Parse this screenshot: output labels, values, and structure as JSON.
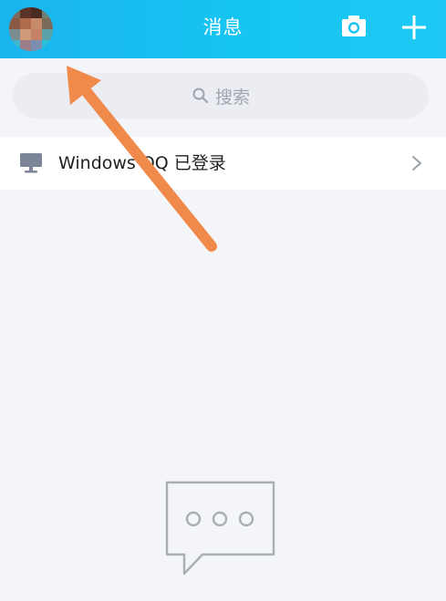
{
  "header": {
    "title": "消息",
    "camera_icon": "camera-icon",
    "add_icon": "plus-icon"
  },
  "search": {
    "placeholder": "搜索",
    "icon": "search-icon"
  },
  "device_row": {
    "icon": "monitor-icon",
    "label": "Windows QQ 已登录",
    "chevron": "chevron-right-icon"
  },
  "empty_state": {
    "icon": "chat-bubble-icon"
  },
  "colors": {
    "header_start": "#1ab4ef",
    "header_end": "#1fc8f4",
    "background": "#f4f5f9",
    "search_bg": "#ebedf3",
    "annotation_arrow": "#f08a4b"
  }
}
